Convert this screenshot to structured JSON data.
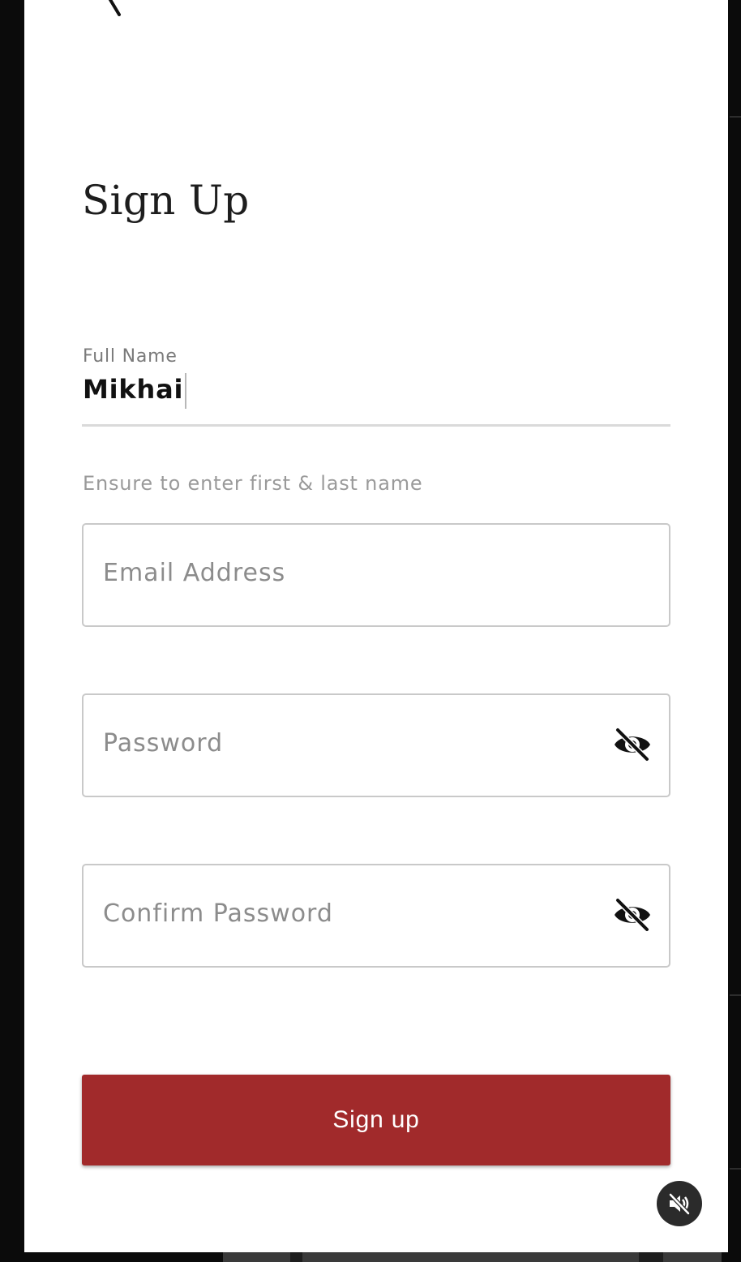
{
  "header": {
    "back_icon": "chevron-left-icon",
    "title": "Sign Up"
  },
  "form": {
    "full_name": {
      "label": "Full Name",
      "value": "Mikhai",
      "hint": "Ensure to enter first & last name"
    },
    "email": {
      "placeholder": "Email Address",
      "value": ""
    },
    "password": {
      "placeholder": "Password",
      "value": "",
      "toggle_icon": "eye-off-icon"
    },
    "confirm_password": {
      "placeholder": "Confirm Password",
      "value": "",
      "toggle_icon": "eye-off-icon"
    },
    "submit_label": "Sign up"
  },
  "overlay": {
    "mute_icon": "volume-off-icon"
  },
  "colors": {
    "accent": "#a12a2b",
    "background": "#ffffff",
    "outer": "#0b0b0b"
  }
}
